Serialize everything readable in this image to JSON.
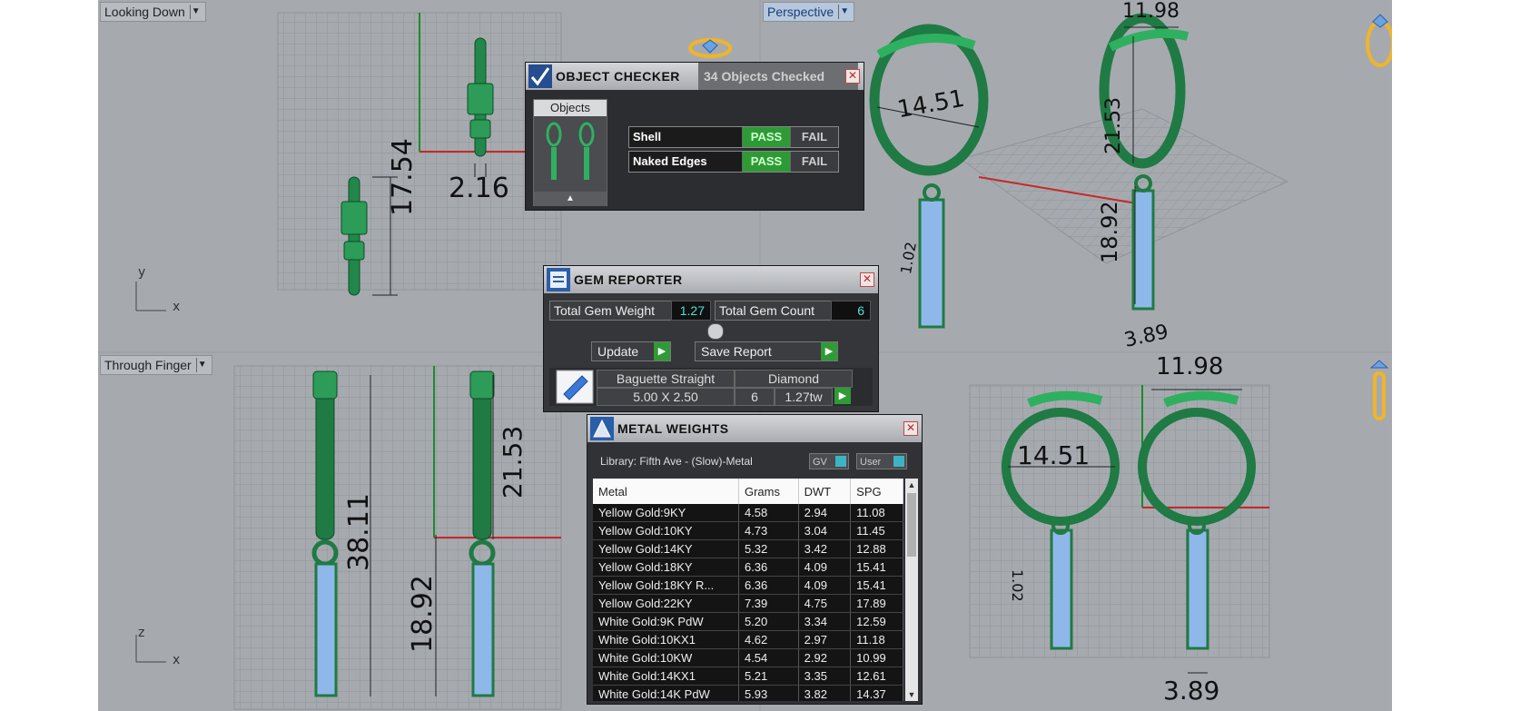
{
  "viewports": {
    "top_left": {
      "label": "Looking Down",
      "axes": {
        "v": "y",
        "h": "x"
      },
      "dims": [
        "2.16",
        "17.54"
      ]
    },
    "top_right": {
      "label": "Perspective",
      "dims": [
        "11.98",
        "14.51",
        "21.53",
        "18.92",
        "1.02",
        "3.89"
      ]
    },
    "bottom_left": {
      "label": "Through Finger",
      "axes": {
        "v": "z",
        "h": "x"
      },
      "dims": [
        "38.11",
        "21.53",
        "18.92"
      ]
    },
    "bottom_right": {
      "dims": [
        "11.98",
        "14.51",
        "1.02",
        "3.89"
      ]
    }
  },
  "object_checker": {
    "title": "OBJECT CHECKER",
    "status": "34  Objects Checked",
    "objects_header": "Objects",
    "checks": [
      {
        "label": "Shell",
        "pass": "PASS",
        "fail": "FAIL"
      },
      {
        "label": "Naked Edges",
        "pass": "PASS",
        "fail": "FAIL"
      }
    ]
  },
  "gem_reporter": {
    "title": "GEM REPORTER",
    "total_weight_label": "Total Gem Weight",
    "total_weight": "1.27",
    "total_count_label": "Total Gem Count",
    "total_count": "6",
    "update_label": "Update",
    "save_label": "Save Report",
    "gem": {
      "cut": "Baguette Straight",
      "material": "Diamond",
      "size": "5.00 X 2.50",
      "count": "6",
      "weight": "1.27tw"
    }
  },
  "metal_weights": {
    "title": "METAL WEIGHTS",
    "library": "Library: Fifth Ave - (Slow)-Metal",
    "toggle_gv": "GV",
    "toggle_user": "User",
    "columns": [
      "Metal",
      "Grams",
      "DWT",
      "SPG"
    ],
    "rows": [
      [
        "Yellow Gold:9KY",
        "4.58",
        "2.94",
        "11.08"
      ],
      [
        "Yellow Gold:10KY",
        "4.73",
        "3.04",
        "11.45"
      ],
      [
        "Yellow Gold:14KY",
        "5.32",
        "3.42",
        "12.88"
      ],
      [
        "Yellow Gold:18KY",
        "6.36",
        "4.09",
        "15.41"
      ],
      [
        "Yellow Gold:18KY R...",
        "6.36",
        "4.09",
        "15.41"
      ],
      [
        "Yellow Gold:22KY",
        "7.39",
        "4.75",
        "17.89"
      ],
      [
        "White Gold:9K PdW",
        "5.20",
        "3.34",
        "12.59"
      ],
      [
        "White Gold:10KX1",
        "4.62",
        "2.97",
        "11.18"
      ],
      [
        "White Gold:10KW",
        "4.54",
        "2.92",
        "10.99"
      ],
      [
        "White Gold:14KX1",
        "5.21",
        "3.35",
        "12.61"
      ],
      [
        "White Gold:14K PdW",
        "5.93",
        "3.82",
        "14.37"
      ]
    ]
  }
}
